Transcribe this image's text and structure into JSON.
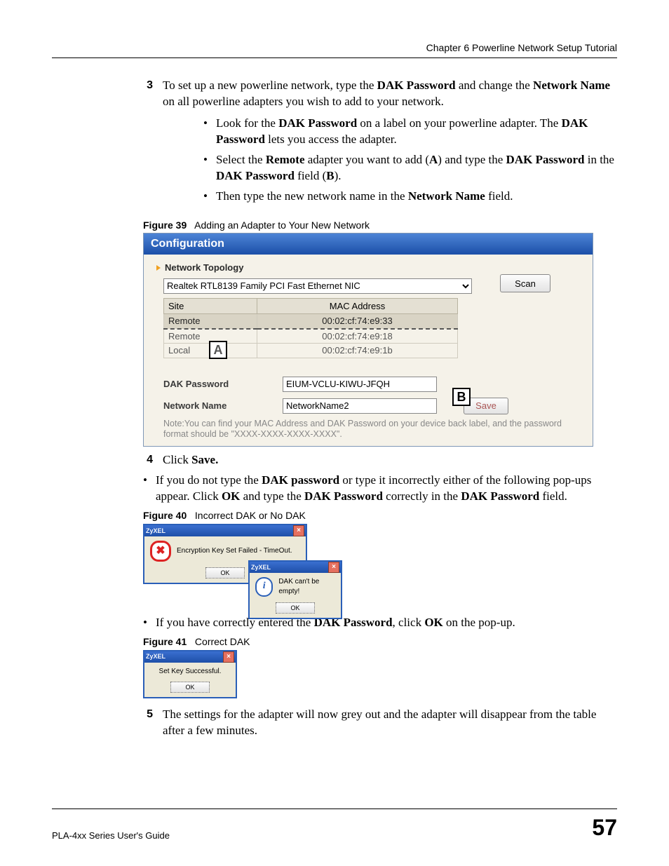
{
  "header": {
    "chapter": "Chapter 6 Powerline Network Setup Tutorial"
  },
  "step3": {
    "num": "3",
    "text1": "To set up a new powerline network, type the ",
    "b1": "DAK Password",
    "text2": " and change the ",
    "b2": "Network Name",
    "text3": " on all powerline adapters you wish to add to your network.",
    "a": {
      "t1": "Look for the ",
      "b1": "DAK Password",
      "t2": " on a label on your powerline adapter. The ",
      "b2": "DAK Password",
      "t3": " lets you access the adapter."
    },
    "b": {
      "t1": "Select the ",
      "b1": "Remote",
      "t2": " adapter you want to add (",
      "b2": "A",
      "t3": ") and type the ",
      "b3": "DAK Password",
      "t4": " in the ",
      "b4": "DAK Password",
      "t5": " field (",
      "b5": "B",
      "t6": ")."
    },
    "c": {
      "t1": "Then type the new network name in the ",
      "b1": "Network Name",
      "t2": " field."
    }
  },
  "fig39": {
    "cap_label": "Figure 39",
    "cap_text": "Adding an Adapter to Your New Network",
    "title": "Configuration",
    "topology": "Network Topology",
    "nic": "Realtek RTL8139 Family PCI Fast Ethernet NIC",
    "scan": "Scan",
    "col_site": "Site",
    "col_mac": "MAC Address",
    "rows": [
      {
        "site": "Remote",
        "mac": "00:02:cf:74:e9:33"
      },
      {
        "site": "Remote",
        "mac": "00:02:cf:74:e9:18"
      },
      {
        "site": "Local",
        "mac": "00:02:cf:74:e9:1b"
      }
    ],
    "markerA": "A",
    "dak_label": "DAK Password",
    "dak_value": "EIUM-VCLU-KIWU-JFQH",
    "net_label": "Network Name",
    "net_value": "NetworkName2",
    "markerB": "B",
    "save": "Save",
    "note": "Note:You can find your MAC Address and DAK Password on your device back label, and the password format should be \"XXXX-XXXX-XXXX-XXXX\"."
  },
  "step4": {
    "num": "4",
    "text1": "Click ",
    "b1": "Save."
  },
  "bad_dak": {
    "t1": "If you do not type the ",
    "b1": "DAK password",
    "t2": " or type it incorrectly either of the following pop-ups appear. Click ",
    "b2": "OK",
    "t3": " and type the ",
    "b3": "DAK Password",
    "t4": " correctly in the ",
    "b4": "DAK Password",
    "t5": " field."
  },
  "fig40": {
    "cap_label": "Figure 40",
    "cap_text": "Incorrect DAK or No DAK",
    "dlg1_title": "ZyXEL",
    "dlg1_msg": "Encryption Key Set Failed - TimeOut.",
    "dlg1_ok": "OK",
    "dlg2_title": "ZyXEL",
    "dlg2_msg": "DAK can't be empty!",
    "dlg2_ok": "OK"
  },
  "good_dak": {
    "t1": "If you have correctly entered the ",
    "b1": "DAK Password",
    "t2": ", click ",
    "b2": "OK",
    "t3": " on the pop-up."
  },
  "fig41": {
    "cap_label": "Figure 41",
    "cap_text": "Correct DAK",
    "dlg_title": "ZyXEL",
    "dlg_msg": "Set Key Successful.",
    "dlg_ok": "OK"
  },
  "step5": {
    "num": "5",
    "text": "The settings for the adapter will now grey out and the adapter will disappear from the table after a few minutes."
  },
  "footer": {
    "guide": "PLA-4xx Series User's Guide",
    "page": "57"
  }
}
